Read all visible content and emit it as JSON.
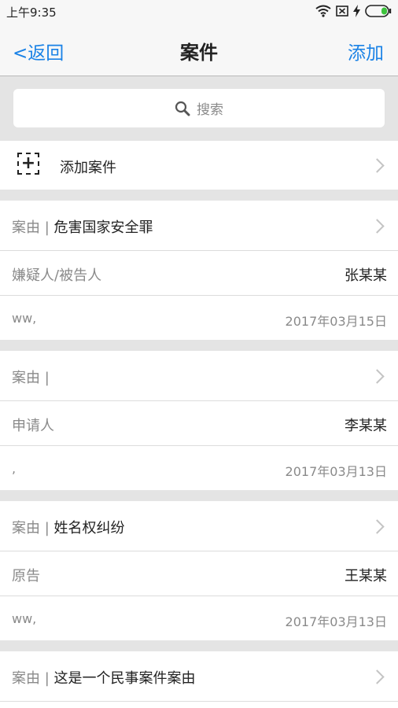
{
  "status_bar": {
    "time": "上午9:35"
  },
  "nav": {
    "back_label": "<返回",
    "title": "案件",
    "add_label": "添加"
  },
  "search": {
    "placeholder": "搜索"
  },
  "add_case": {
    "label": "添加案件"
  },
  "cases": [
    {
      "cause_label": "案由 | ",
      "cause": "危害国家安全罪",
      "party_label": "嫌疑人/被告人",
      "party": "张某某",
      "note": "ww,",
      "date": "2017年03月15日"
    },
    {
      "cause_label": "案由 | ",
      "cause": "",
      "party_label": "申请人",
      "party": "李某某",
      "note": ",",
      "date": "2017年03月13日"
    },
    {
      "cause_label": "案由 | ",
      "cause": "姓名权纠纷",
      "party_label": "原告",
      "party": "王某某",
      "note": "ww,",
      "date": "2017年03月13日"
    },
    {
      "cause_label": "案由 | ",
      "cause": "这是一个民事案件案由"
    }
  ],
  "colors": {
    "accent": "#1a82e6",
    "separator": "#e4e4e4",
    "muted_text": "#8a8a8a"
  },
  "icons": [
    "wifi-icon",
    "sim-off-icon",
    "charging-icon",
    "battery-icon",
    "search-icon",
    "add-icon",
    "chevron-right-icon"
  ]
}
